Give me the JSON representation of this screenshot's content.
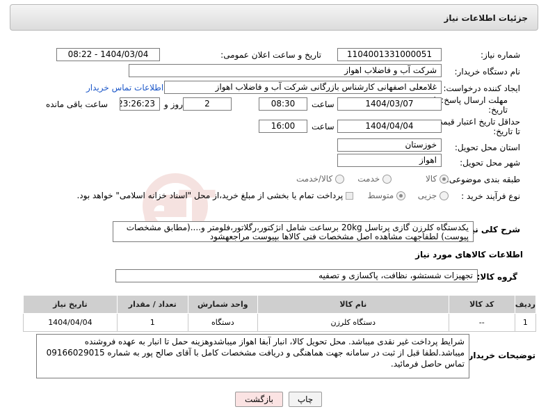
{
  "header": {
    "title": "جزئیات اطلاعات نیاز"
  },
  "form": {
    "need_number_label": "شماره نیاز:",
    "need_number": "1104001331000051",
    "announce_label": "تاریخ و ساعت اعلان عمومی:",
    "announce_value": "1404/03/04 - 08:22",
    "buyer_org_label": "نام دستگاه خریدار:",
    "buyer_org": "شرکت آب و فاضلاب اهواز",
    "requester_label": "ایجاد کننده درخواست:",
    "requester": "غلامعلی اصفهانی کارشناس بازرگانی شرکت آب و فاضلاب اهواز",
    "contact_link": "اطلاعات تماس خریدار",
    "deadline_label_1": "مهلت ارسال پاسخ: تا",
    "deadline_label_2": "تاریخ:",
    "deadline_date": "1404/03/07",
    "time_label": "ساعت",
    "deadline_time": "08:30",
    "days_value": "2",
    "days_label": "روز و",
    "remaining_time": "23:26:23",
    "remaining_label": "ساعت باقی مانده",
    "validity_label_1": "حداقل تاریخ اعتبار قیمت:",
    "validity_label_2": "تا تاریخ:",
    "validity_date": "1404/04/04",
    "validity_time": "16:00",
    "province_label": "استان محل تحویل:",
    "province": "خوزستان",
    "city_label": "شهر محل تحویل:",
    "city": "اهواز",
    "category_label": "طبقه بندی موضوعی:",
    "category_options": [
      "کالا",
      "خدمت",
      "کالا/خدمت"
    ],
    "category_selected": "کالا",
    "process_label": "نوع فرآیند خرید :",
    "process_options": [
      "جزیی",
      "متوسط"
    ],
    "process_selected": "متوسط",
    "payment_note": "پرداخت تمام یا بخشی از مبلغ خرید،از محل \"اسناد خزانه اسلامی\" خواهد بود.",
    "description_label": "شرح کلی نیاز:",
    "description": "یکدستگاه کلرزن گازی پرتاسل 20kg برساعت شامل انژکتور،رگلاتور،فلومتر و....(مطابق مشخصات پیوست) لطفاجهت مشاهده اصل مشخصات فنی کالاها بپیوست مراجعهشود"
  },
  "goods": {
    "section_title": "اطلاعات کالاهای مورد نیاز",
    "group_label": "گروه کالا:",
    "group_value": "تجهیزات شستشو، نظافت، پاکسازی و تصفیه",
    "columns": [
      "ردیف",
      "کد کالا",
      "نام کالا",
      "واحد شمارش",
      "تعداد / مقدار",
      "تاریخ نیاز"
    ],
    "rows": [
      [
        "1",
        "--",
        "دستگاه کلرزن",
        "دستگاه",
        "1",
        "1404/04/04"
      ]
    ]
  },
  "notes": {
    "label": "توضیحات خریدار:",
    "text": "شرایط پرداخت غیر نقدی میباشد. محل تحویل کالا، انبار آبفا اهواز میباشدوهزینه حمل تا انبار به عهده فروشنده میباشد.لطفا قبل از ثبت در سامانه جهت هماهنگی و دریافت مشخصات کامل با آقای  صالح پور به شماره 09166029015 تماس حاصل فرمائید."
  },
  "buttons": {
    "print": "چاپ",
    "back": "بازگشت"
  },
  "watermark": {
    "text": "AriaTender.neT"
  },
  "colors": {
    "link": "#1c57c8",
    "back_button": "#fbe3e3",
    "table_header": "#cfcfcf"
  }
}
